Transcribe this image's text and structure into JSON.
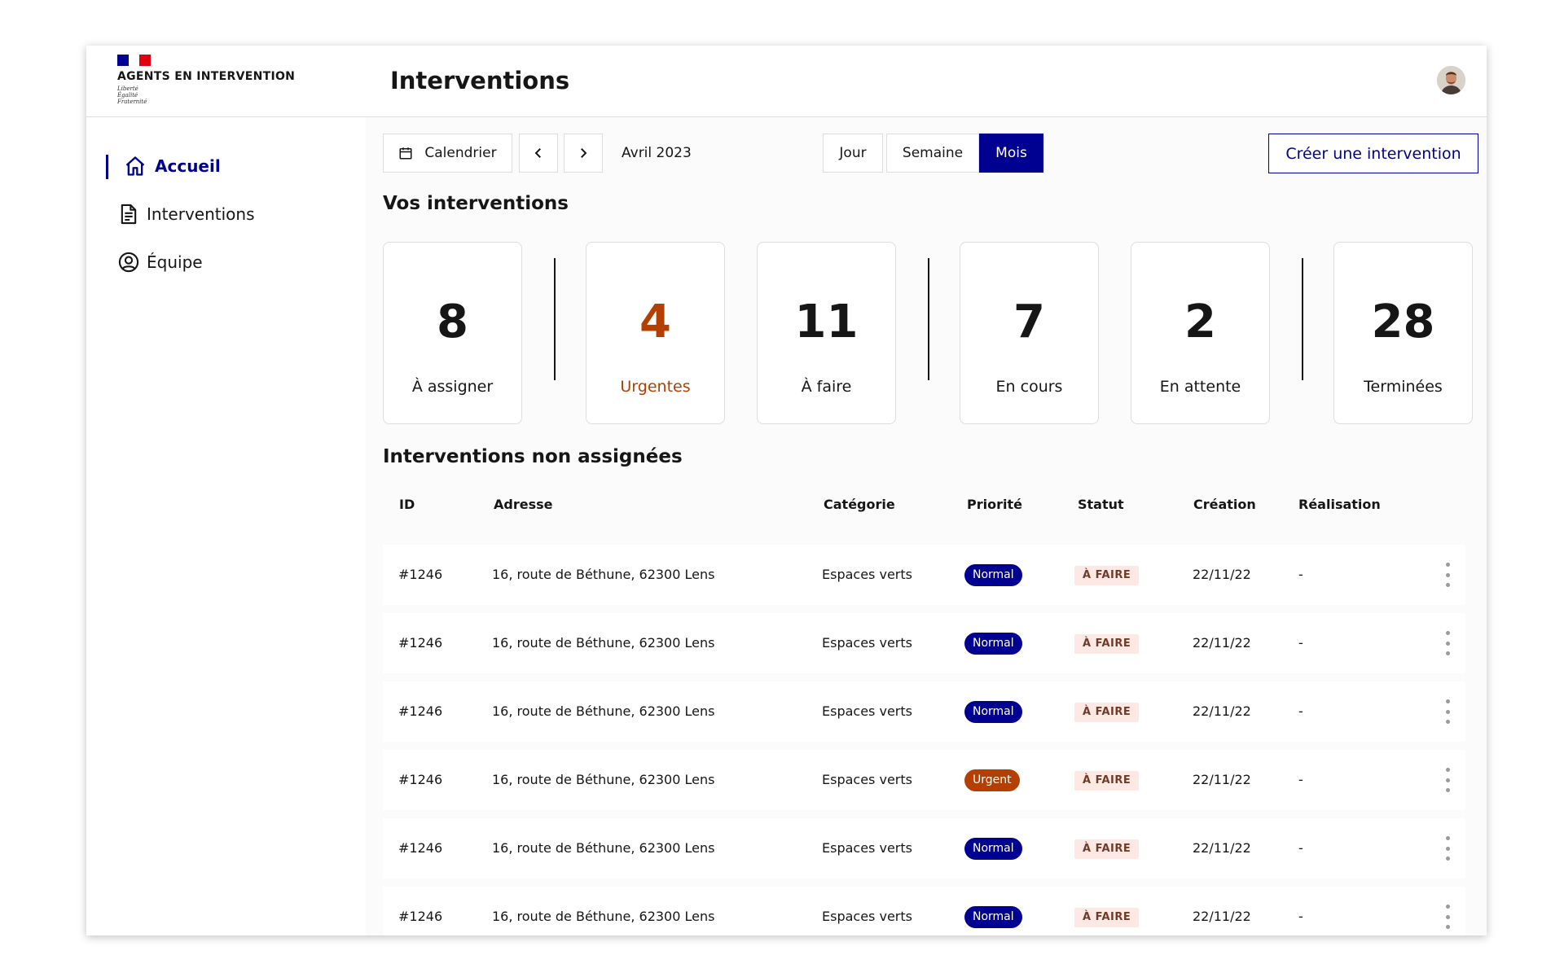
{
  "brand": {
    "name": "AGENTS EN INTERVENTION",
    "motto": [
      "Liberté",
      "Égalité",
      "Fraternité"
    ],
    "flag_colors": [
      "#000091",
      "#ffffff",
      "#e1000f"
    ]
  },
  "sidebar": {
    "items": [
      {
        "label": "Accueil",
        "icon": "home-icon",
        "active": true
      },
      {
        "label": "Interventions",
        "icon": "document-icon",
        "active": false
      },
      {
        "label": "Équipe",
        "icon": "user-circle-icon",
        "active": false
      }
    ]
  },
  "header": {
    "title": "Interventions",
    "avatar_icon": "avatar"
  },
  "toolbar": {
    "calendar_label": "Calendrier",
    "prev_icon": "chevron-left-icon",
    "next_icon": "chevron-right-icon",
    "month": "Avril 2023",
    "views": [
      {
        "label": "Jour",
        "active": false
      },
      {
        "label": "Semaine",
        "active": false
      },
      {
        "label": "Mois",
        "active": true
      }
    ],
    "create_label": "Créer une intervention"
  },
  "overview": {
    "title": "Vos interventions",
    "stats": [
      {
        "value": "8",
        "label": "À assigner"
      },
      {
        "value": "4",
        "label": "Urgentes"
      },
      {
        "value": "11",
        "label": "À faire"
      },
      {
        "value": "7",
        "label": "En cours"
      },
      {
        "value": "2",
        "label": "En attente"
      },
      {
        "value": "28",
        "label": "Terminées"
      }
    ]
  },
  "table": {
    "title": "Interventions non assignées",
    "columns": [
      "ID",
      "Adresse",
      "Catégorie",
      "Priorité",
      "Statut",
      "Création",
      "Réalisation"
    ],
    "rows": [
      {
        "id": "#1246",
        "address": "16, route de Béthune, 62300 Lens",
        "category": "Espaces verts",
        "priority": "Normal",
        "status": "À FAIRE",
        "created": "22/11/22",
        "done": "-"
      },
      {
        "id": "#1246",
        "address": "16, route de Béthune, 62300 Lens",
        "category": "Espaces verts",
        "priority": "Normal",
        "status": "À FAIRE",
        "created": "22/11/22",
        "done": "-"
      },
      {
        "id": "#1246",
        "address": "16, route de Béthune, 62300 Lens",
        "category": "Espaces verts",
        "priority": "Normal",
        "status": "À FAIRE",
        "created": "22/11/22",
        "done": "-"
      },
      {
        "id": "#1246",
        "address": "16, route de Béthune, 62300 Lens",
        "category": "Espaces verts",
        "priority": "Urgent",
        "status": "À FAIRE",
        "created": "22/11/22",
        "done": "-"
      },
      {
        "id": "#1246",
        "address": "16, route de Béthune, 62300 Lens",
        "category": "Espaces verts",
        "priority": "Normal",
        "status": "À FAIRE",
        "created": "22/11/22",
        "done": "-"
      },
      {
        "id": "#1246",
        "address": "16, route de Béthune, 62300 Lens",
        "category": "Espaces verts",
        "priority": "Normal",
        "status": "À FAIRE",
        "created": "22/11/22",
        "done": "-"
      }
    ]
  },
  "colors": {
    "primary": "#000091",
    "urgent": "#b34000",
    "status_bg": "#fde8e4"
  }
}
